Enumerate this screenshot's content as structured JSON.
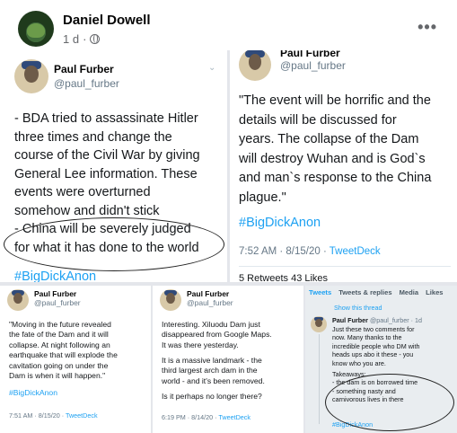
{
  "post": {
    "author": "Daniel Dowell",
    "time": "1 d",
    "time_sep": "·",
    "more_label": "•••"
  },
  "tweet_top_left": {
    "name": "Paul Furber",
    "handle": "@paul_furber",
    "chevron": "⌄",
    "lines": [
      "- BDA tried to assassinate Hitler",
      "three times and change the",
      "course of the Civil War by giving",
      "General Lee information. These",
      "events were overturned",
      "somehow and didn't stick",
      "- China will be severely judged",
      "for what it has done to the world"
    ],
    "hashtag": "#BigDickAnon"
  },
  "tweet_top_right": {
    "name": "Paul Furber",
    "handle": "@paul_furber",
    "lines": [
      "\"The event will be horrific and the",
      "details will be discussed for",
      "years. The collapse of the Dam",
      "will destroy Wuhan and is God`s",
      "and man`s response to the China",
      "plague.\""
    ],
    "hashtag": "#BigDickAnon",
    "timestamp": "7:52 AM · 8/15/20 · ",
    "source": "TweetDeck",
    "stats": "5 Retweets  43 Likes"
  },
  "tweet_bottom_left": {
    "name": "Paul Furber",
    "handle": "@paul_furber",
    "lines": [
      "\"Moving in the future revealed",
      "the fate of the Dam and it will",
      "collapse. At night following an",
      "earthquake that will explode the",
      "cavitation going on under the",
      "Dam is when it will happen.\""
    ],
    "hashtag": "#BigDickAnon",
    "timestamp": "7:51 AM · 8/15/20 · ",
    "source": "TweetDeck"
  },
  "tweet_bottom_middle": {
    "name": "Paul Furber",
    "handle": "@paul_furber",
    "para1": [
      "Interesting. Xiluodu Dam just",
      "disappeared from Google Maps.",
      "It was there yesterday."
    ],
    "para2": [
      "It is a massive landmark - the",
      "third largest arch dam in the",
      "world - and it's been removed."
    ],
    "para3": "Is it perhaps no longer there?",
    "timestamp": "6:19 PM · 8/14/20 · ",
    "source": "TweetDeck"
  },
  "thread_panel": {
    "tabs": [
      "Tweets",
      "Tweets & replies",
      "Media",
      "Likes"
    ],
    "show_thread": "Show this thread",
    "name": "Paul Furber",
    "handle": "@paul_furber · 1d",
    "lines": [
      "Just these two comments for",
      "now. Many thanks to the",
      "incredible people who DM with",
      "heads ups abo it these - you",
      "know who you are."
    ],
    "takeaways": [
      "Takeaways:",
      "- the dam is on borrowed time",
      "- something nasty and",
      "carnivorous lives in there"
    ],
    "hashtag": "#BigDickAnon"
  },
  "colors": {
    "link_blue": "#1da1f2",
    "muted_gray": "#657786",
    "facebook_gray": "#65676b"
  }
}
